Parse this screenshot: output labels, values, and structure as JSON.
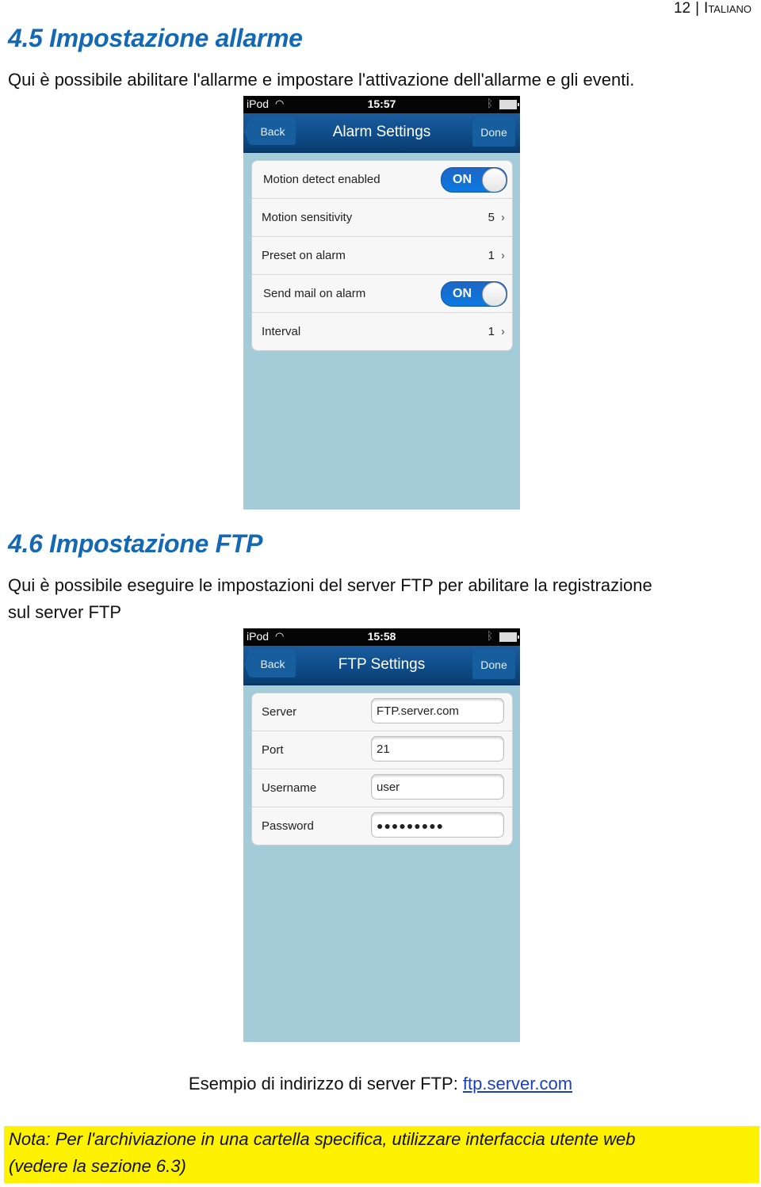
{
  "page_header": {
    "page_number": "12",
    "language": "Italiano"
  },
  "section_alarm": {
    "heading": "4.5 Impostazione allarme",
    "description": "Qui è possibile abilitare l'allarme e impostare l'attivazione dell'allarme e gli eventi.",
    "screenshot": {
      "status_bar": {
        "carrier": "iPod",
        "time": "15:57",
        "wifi_icon": "wifi-icon",
        "bluetooth_icon": "bluetooth-icon",
        "battery_icon": "battery-icon"
      },
      "nav": {
        "back_label": "Back",
        "title": "Alarm Settings",
        "done_label": "Done"
      },
      "rows": [
        {
          "label": "Motion detect enabled",
          "type": "toggle",
          "value": "ON"
        },
        {
          "label": "Motion sensitivity",
          "type": "disclosure",
          "value": "5"
        },
        {
          "label": "Preset on alarm",
          "type": "disclosure",
          "value": "1"
        },
        {
          "label": "Send mail on alarm",
          "type": "toggle",
          "value": "ON"
        },
        {
          "label": "Interval",
          "type": "disclosure",
          "value": "1"
        }
      ],
      "chevron_glyph": "›"
    }
  },
  "section_ftp": {
    "heading": "4.6 Impostazione FTP",
    "description_line1": "Qui è possibile eseguire le impostazioni del server FTP per abilitare la registrazione",
    "description_line2": "sul server FTP",
    "screenshot": {
      "status_bar": {
        "carrier": "iPod",
        "time": "15:58",
        "wifi_icon": "wifi-icon",
        "bluetooth_icon": "bluetooth-icon",
        "battery_icon": "battery-icon"
      },
      "nav": {
        "back_label": "Back",
        "title": "FTP Settings",
        "done_label": "Done"
      },
      "fields": [
        {
          "label": "Server",
          "value": "FTP.server.com"
        },
        {
          "label": "Port",
          "value": "21"
        },
        {
          "label": "Username",
          "value": "user"
        },
        {
          "label": "Password",
          "value": "●●●●●●●●●"
        }
      ]
    },
    "example_text": "Esempio di indirizzo di server FTP: ",
    "example_link": "ftp.server.com"
  },
  "note": {
    "line1": "Nota: Per l'archiviazione in una cartella specifica, utilizzare interfaccia utente web",
    "line2": "(vedere la sezione 6.3)",
    "highlight_color": "#fff200"
  },
  "colors": {
    "heading": "#1569b4",
    "phone_background": "#a4cbd8",
    "navbar": "#0f4d8a",
    "toggle_on": "#1e66c6",
    "link": "#1a3fbf"
  }
}
